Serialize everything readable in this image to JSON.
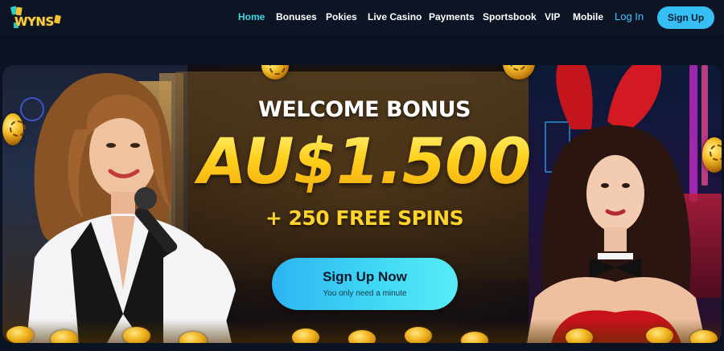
{
  "brand": {
    "logo_text": "WYNS"
  },
  "nav": {
    "items": [
      {
        "label": "Home",
        "active": true
      },
      {
        "label": "Bonuses"
      },
      {
        "label": "Pokies"
      },
      {
        "label": "Live Casino"
      },
      {
        "label": "Payments"
      },
      {
        "label": "Sportsbook"
      },
      {
        "label": "VIP"
      },
      {
        "label": "Mobile"
      }
    ],
    "login_label": "Log In",
    "signup_label": "Sign Up"
  },
  "hero": {
    "headline": "WELCOME BONUS",
    "amount": "AU$1.500",
    "extra": "+ 250 FREE SPINS",
    "cta_label": "Sign Up Now",
    "cta_sub": "You only need a minute"
  },
  "colors": {
    "accent": "#35bff5",
    "active_nav": "#3ed6e8",
    "gold": "#ffd21a",
    "background": "#0b1322"
  }
}
